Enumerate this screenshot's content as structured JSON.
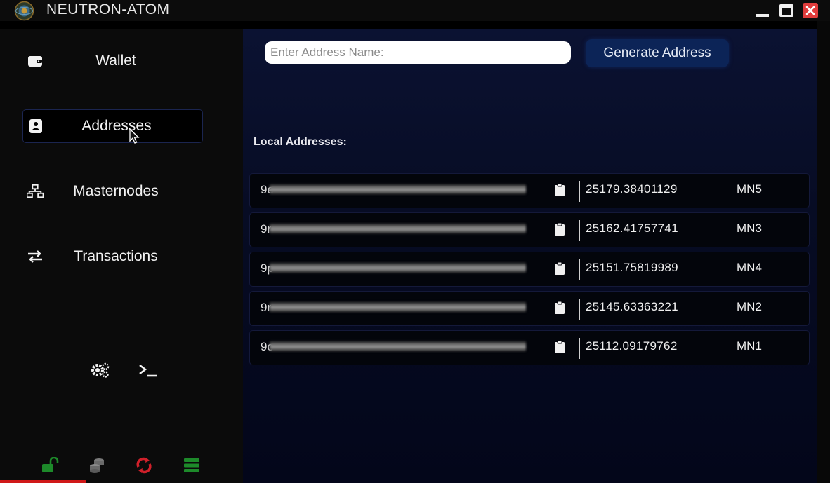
{
  "window": {
    "title": "NEUTRON-ATOM"
  },
  "sidebar": {
    "items": [
      {
        "label": "Wallet",
        "icon": "wallet-icon",
        "active": false
      },
      {
        "label": "Addresses",
        "icon": "contact-card-icon",
        "active": true
      },
      {
        "label": "Masternodes",
        "icon": "network-icon",
        "active": false
      },
      {
        "label": "Transactions",
        "icon": "swap-arrows-icon",
        "active": false
      }
    ],
    "tools": [
      "settings-gears-icon",
      "console-prompt-icon"
    ],
    "status_icons": [
      {
        "icon": "unlocked-padlock-icon",
        "color": "#1d8a2a"
      },
      {
        "icon": "coin-stack-icon",
        "color": "#7a7a7a"
      },
      {
        "icon": "sync-error-icon",
        "color": "#d0202a"
      },
      {
        "icon": "database-icon",
        "color": "#1d8a2a"
      }
    ]
  },
  "main": {
    "address_input": {
      "placeholder": "Enter Address Name:",
      "value": ""
    },
    "generate_button_label": "Generate Address",
    "section_label": "Local Addresses:",
    "addresses": [
      {
        "prefix": "9e",
        "amount": "25179.38401129",
        "name": "MN5"
      },
      {
        "prefix": "9r",
        "amount": "25162.41757741",
        "name": "MN3"
      },
      {
        "prefix": "9p",
        "amount": "25151.75819989",
        "name": "MN4"
      },
      {
        "prefix": "9r",
        "amount": "25145.63363221",
        "name": "MN2"
      },
      {
        "prefix": "9c",
        "amount": "25112.09179762",
        "name": "MN1"
      }
    ]
  },
  "colors": {
    "accent": "#0c2457",
    "panel_background": "#0b1232",
    "sidebar_background": "#0b0b0b",
    "close_button": "#e03c3c"
  }
}
